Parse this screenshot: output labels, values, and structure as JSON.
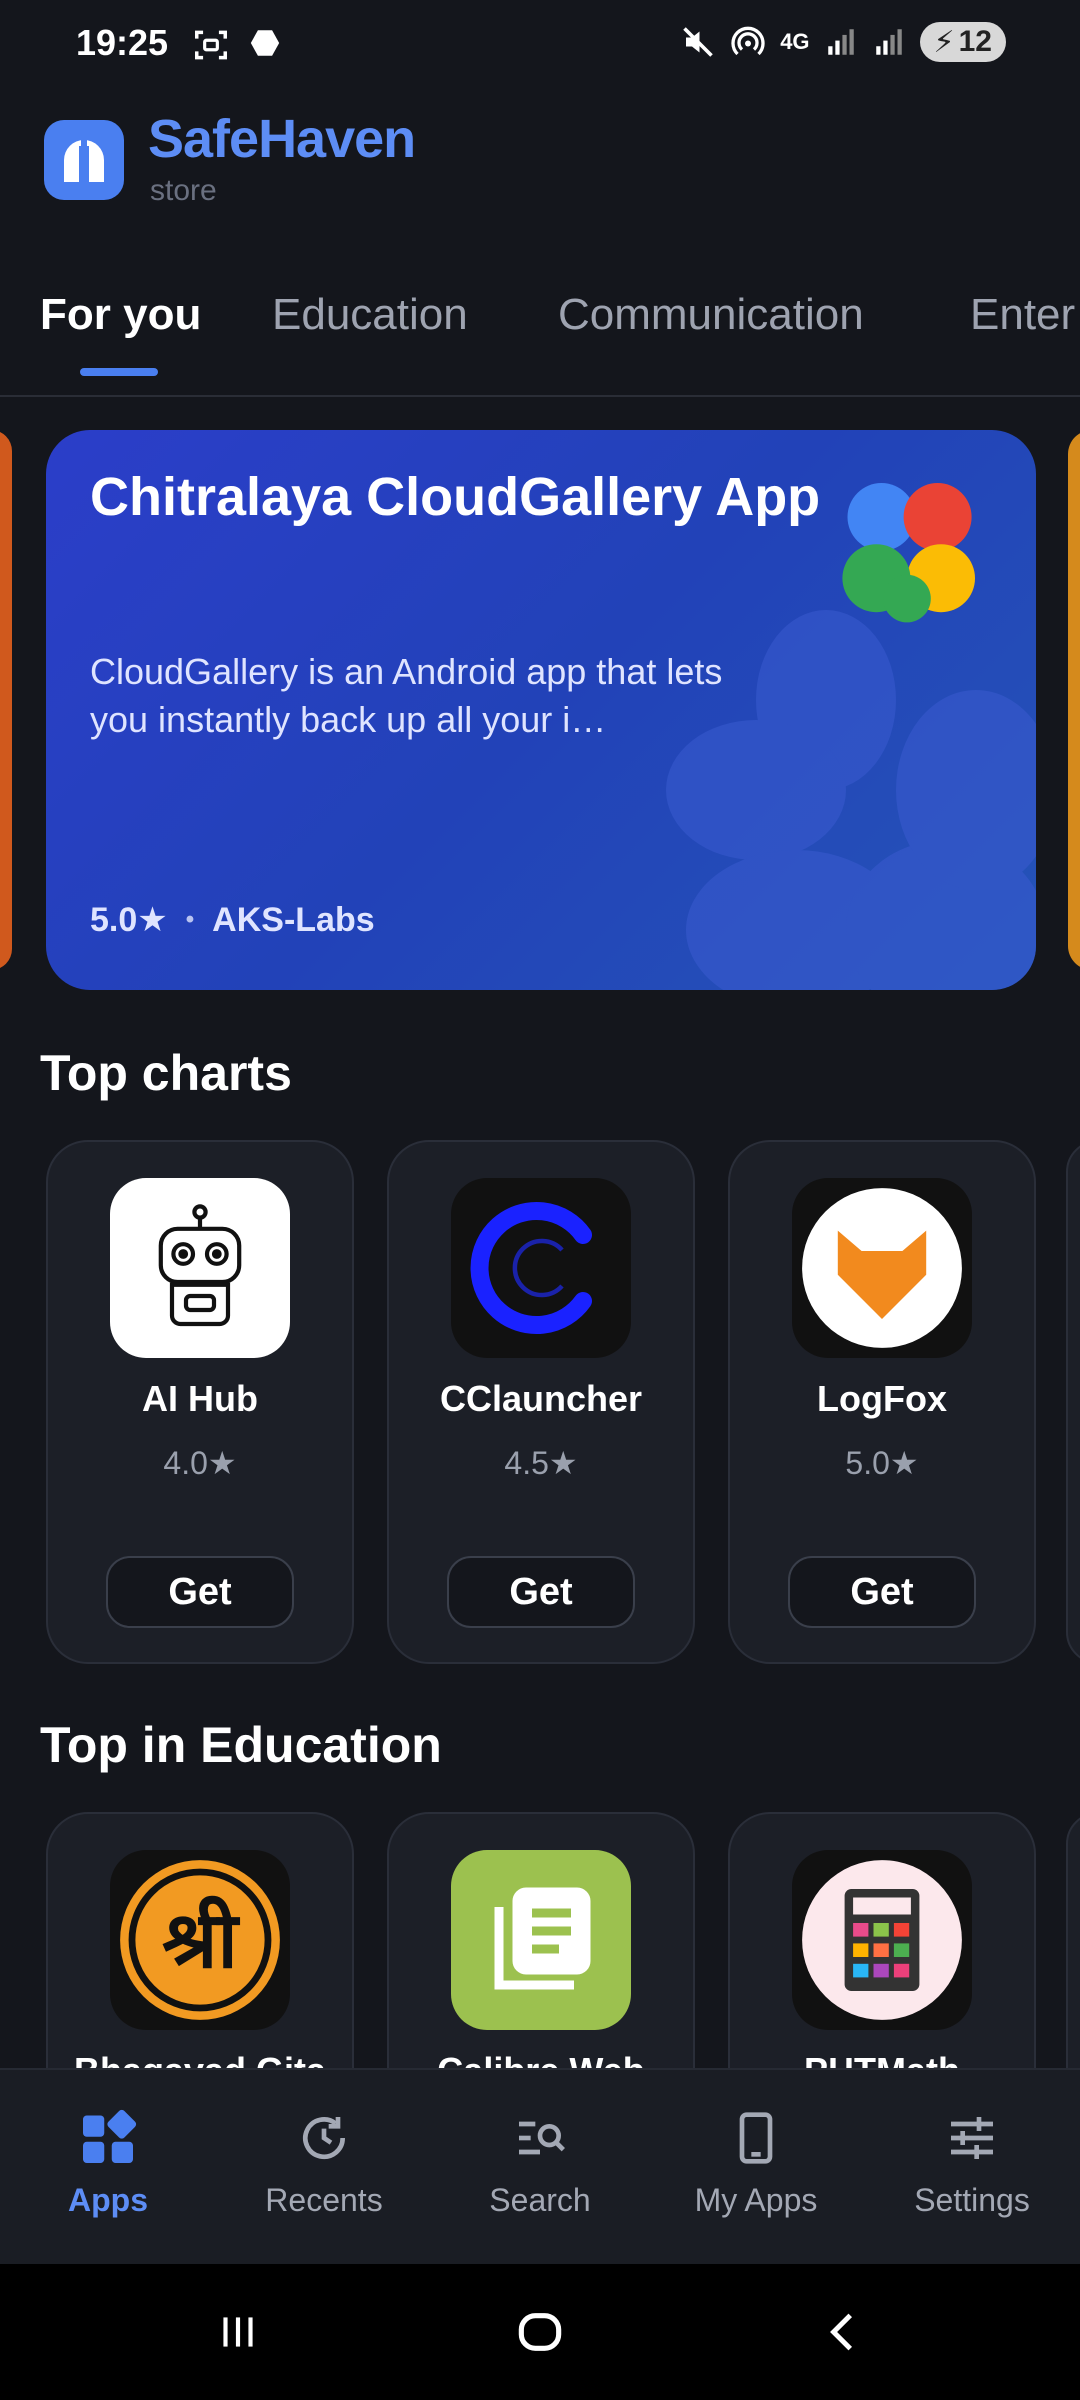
{
  "status_bar": {
    "time": "19:25",
    "network": "4G",
    "battery": "12"
  },
  "header": {
    "brand": "SafeHaven",
    "sub": "store"
  },
  "tabs": [
    {
      "label": "For you",
      "active": true
    },
    {
      "label": "Education"
    },
    {
      "label": "Communication"
    },
    {
      "label": "Enter"
    }
  ],
  "hero": {
    "title": "Chitralaya CloudGallery App",
    "description": "CloudGallery is an Android app that lets you instantly back up all your i…",
    "rating": "5.0★",
    "separator": "•",
    "developer": "AKS-Labs"
  },
  "top_charts": {
    "title": "Top charts",
    "apps": [
      {
        "name": "AI Hub",
        "rating": "4.0★",
        "action": "Get"
      },
      {
        "name": "CClauncher",
        "rating": "4.5★",
        "action": "Get"
      },
      {
        "name": "LogFox",
        "rating": "5.0★",
        "action": "Get"
      }
    ]
  },
  "top_education": {
    "title": "Top in Education",
    "apps": [
      {
        "name": "Bhagavad Gita"
      },
      {
        "name": "Calibre Web"
      },
      {
        "name": "PHTMath"
      }
    ]
  },
  "bottom_nav": [
    {
      "label": "Apps",
      "icon": "apps-grid-icon",
      "active": true
    },
    {
      "label": "Recents",
      "icon": "history-icon"
    },
    {
      "label": "Search",
      "icon": "search-list-icon"
    },
    {
      "label": "My Apps",
      "icon": "phone-icon"
    },
    {
      "label": "Settings",
      "icon": "sliders-icon"
    }
  ],
  "colors": {
    "accent": "#4a7ff0",
    "background": "#14161c",
    "card": "#1c1f27"
  }
}
